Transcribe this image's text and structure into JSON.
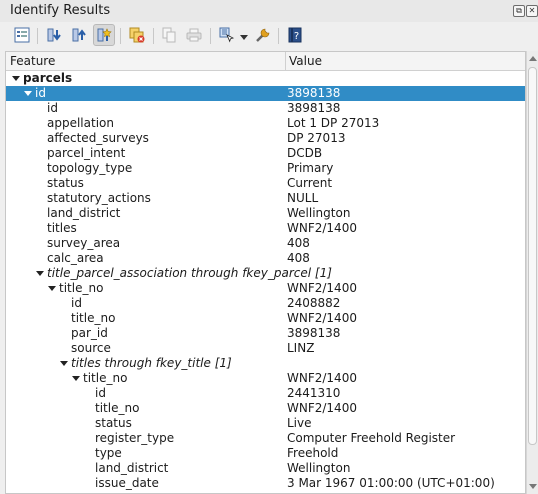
{
  "window": {
    "title": "Identify Results",
    "float_glyph": "⧉",
    "close_glyph": "✕"
  },
  "toolbar": {
    "icons": [
      "tree-view-icon",
      "expand-all-icon",
      "collapse-all-icon",
      "expand-new-icon",
      "clear-results-icon",
      "copy-feature-icon",
      "print-icon",
      "identify-mode-icon",
      "settings-icon",
      "help-icon"
    ]
  },
  "table": {
    "headers": {
      "feature": "Feature",
      "value": "Value"
    },
    "rows": [
      {
        "feature": "parcels",
        "value": "",
        "depth": 0,
        "arrow": true,
        "style": "bold"
      },
      {
        "feature": "id",
        "value": "3898138",
        "depth": 1,
        "arrow": true,
        "selected": true
      },
      {
        "feature": "id",
        "value": "3898138",
        "depth": 2
      },
      {
        "feature": "appellation",
        "value": "Lot 1 DP 27013",
        "depth": 2
      },
      {
        "feature": "affected_surveys",
        "value": "DP 27013",
        "depth": 2
      },
      {
        "feature": "parcel_intent",
        "value": "DCDB",
        "depth": 2
      },
      {
        "feature": "topology_type",
        "value": "Primary",
        "depth": 2
      },
      {
        "feature": "status",
        "value": "Current",
        "depth": 2
      },
      {
        "feature": "statutory_actions",
        "value": "NULL",
        "depth": 2
      },
      {
        "feature": "land_district",
        "value": "Wellington",
        "depth": 2
      },
      {
        "feature": "titles",
        "value": "WNF2/1400",
        "depth": 2
      },
      {
        "feature": "survey_area",
        "value": "408",
        "depth": 2
      },
      {
        "feature": "calc_area",
        "value": "408",
        "depth": 2
      },
      {
        "feature": "title_parcel_association through fkey_parcel [1]",
        "value": "",
        "depth": 2,
        "arrow": true,
        "style": "italic"
      },
      {
        "feature": "title_no",
        "value": "WNF2/1400",
        "depth": 3,
        "arrow": true
      },
      {
        "feature": "id",
        "value": "2408882",
        "depth": 4
      },
      {
        "feature": "title_no",
        "value": "WNF2/1400",
        "depth": 4
      },
      {
        "feature": "par_id",
        "value": "3898138",
        "depth": 4
      },
      {
        "feature": "source",
        "value": "LINZ",
        "depth": 4
      },
      {
        "feature": "titles through fkey_title [1]",
        "value": "",
        "depth": 4,
        "arrow": true,
        "style": "italic"
      },
      {
        "feature": "title_no",
        "value": "WNF2/1400",
        "depth": 5,
        "arrow": true
      },
      {
        "feature": "id",
        "value": "2441310",
        "depth": 6
      },
      {
        "feature": "title_no",
        "value": "WNF2/1400",
        "depth": 6
      },
      {
        "feature": "status",
        "value": "Live",
        "depth": 6
      },
      {
        "feature": "register_type",
        "value": "Computer Freehold Register",
        "depth": 6
      },
      {
        "feature": "type",
        "value": "Freehold",
        "depth": 6
      },
      {
        "feature": "land_district",
        "value": "Wellington",
        "depth": 6
      },
      {
        "feature": "issue_date",
        "value": "3 Mar 1967 01:00:00 (UTC+01:00)",
        "depth": 6
      }
    ]
  },
  "colors": {
    "selection": "#308cc6",
    "background": "#efefef"
  }
}
